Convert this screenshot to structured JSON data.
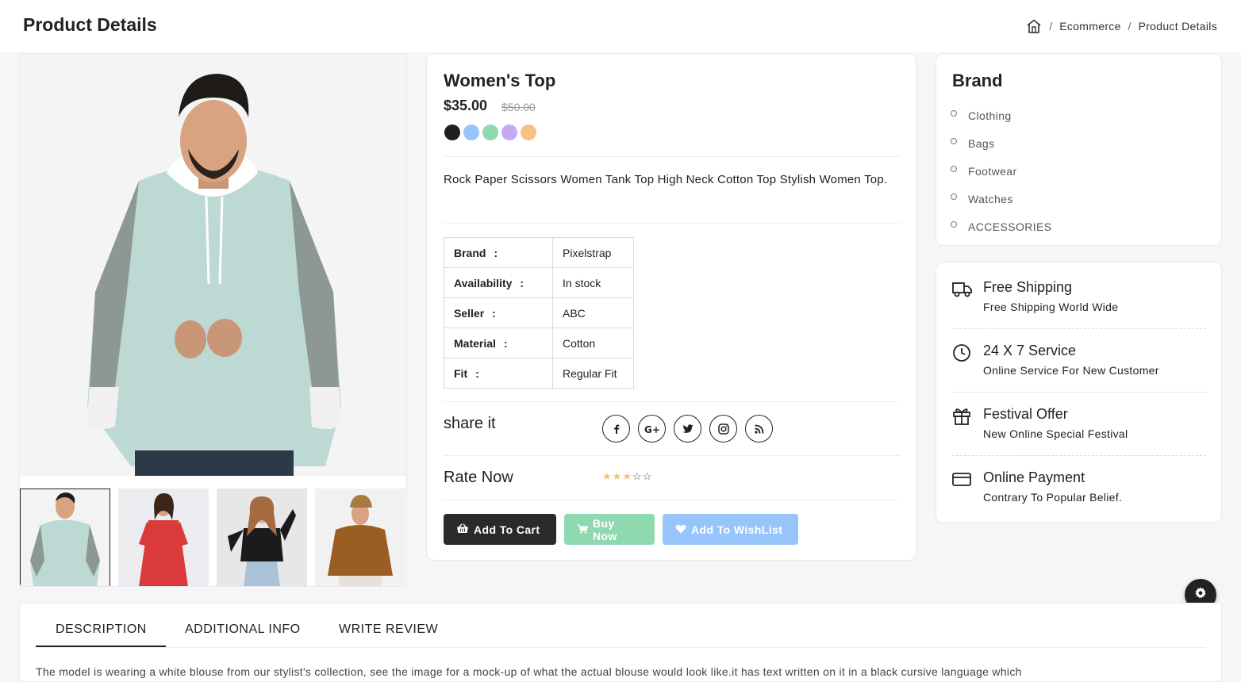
{
  "header": {
    "title": "Product Details",
    "breadcrumb": [
      "Ecommerce",
      "Product Details"
    ],
    "home_icon": "home-icon"
  },
  "gallery": {
    "main_image": "man-in-mint-hoodie",
    "thumbnails": [
      "man-in-mint-hoodie",
      "woman-in-red-floral-dress",
      "woman-in-black-jacket",
      "man-in-brown-hoodie"
    ],
    "active_index": 0
  },
  "product": {
    "name": "Women's Top",
    "price": "$35.00",
    "old_price": "$50.00",
    "colors": [
      "#1f1f1f",
      "#97c4fb",
      "#8fd9b0",
      "#c6a8f5",
      "#f7c185"
    ],
    "description": "Rock Paper Scissors Women Tank Top High Neck Cotton Top Stylish Women Top.",
    "specs": [
      {
        "key": "Brand",
        "value": "Pixelstrap"
      },
      {
        "key": "Availability",
        "value": "In stock"
      },
      {
        "key": "Seller",
        "value": "ABC"
      },
      {
        "key": "Material",
        "value": "Cotton"
      },
      {
        "key": "Fit",
        "value": "Regular Fit"
      }
    ],
    "share_label": "share it",
    "share_icons": [
      "facebook-icon",
      "google-plus-icon",
      "twitter-icon",
      "instagram-icon",
      "rss-icon"
    ],
    "rate_label": "Rate Now",
    "rating": 3,
    "rating_max": 5,
    "buttons": {
      "cart": "Add To Cart",
      "buy": "Buy Now",
      "wishlist": "Add To WishList"
    }
  },
  "brand": {
    "title": "Brand",
    "items": [
      "Clothing",
      "Bags",
      "Footwear",
      "Watches",
      "ACCESSORIES"
    ]
  },
  "services": [
    {
      "icon": "truck-icon",
      "title": "Free Shipping",
      "subtitle": "Free Shipping World Wide"
    },
    {
      "icon": "clock-icon",
      "title": "24 X 7 Service",
      "subtitle": "Online Service For New Customer"
    },
    {
      "icon": "gift-icon",
      "title": "Festival Offer",
      "subtitle": "New Online Special Festival"
    },
    {
      "icon": "credit-card-icon",
      "title": "Online Payment",
      "subtitle": "Contrary To Popular Belief."
    }
  ],
  "tabs": {
    "items": [
      "DESCRIPTION",
      "ADDITIONAL INFO",
      "WRITE REVIEW"
    ],
    "active": "DESCRIPTION",
    "content": "The model is wearing a white blouse from our stylist's collection, see the image for a mock-up of what the actual blouse would look like.it has text written on it in a black cursive language which"
  },
  "settings_icon": "gear-icon"
}
